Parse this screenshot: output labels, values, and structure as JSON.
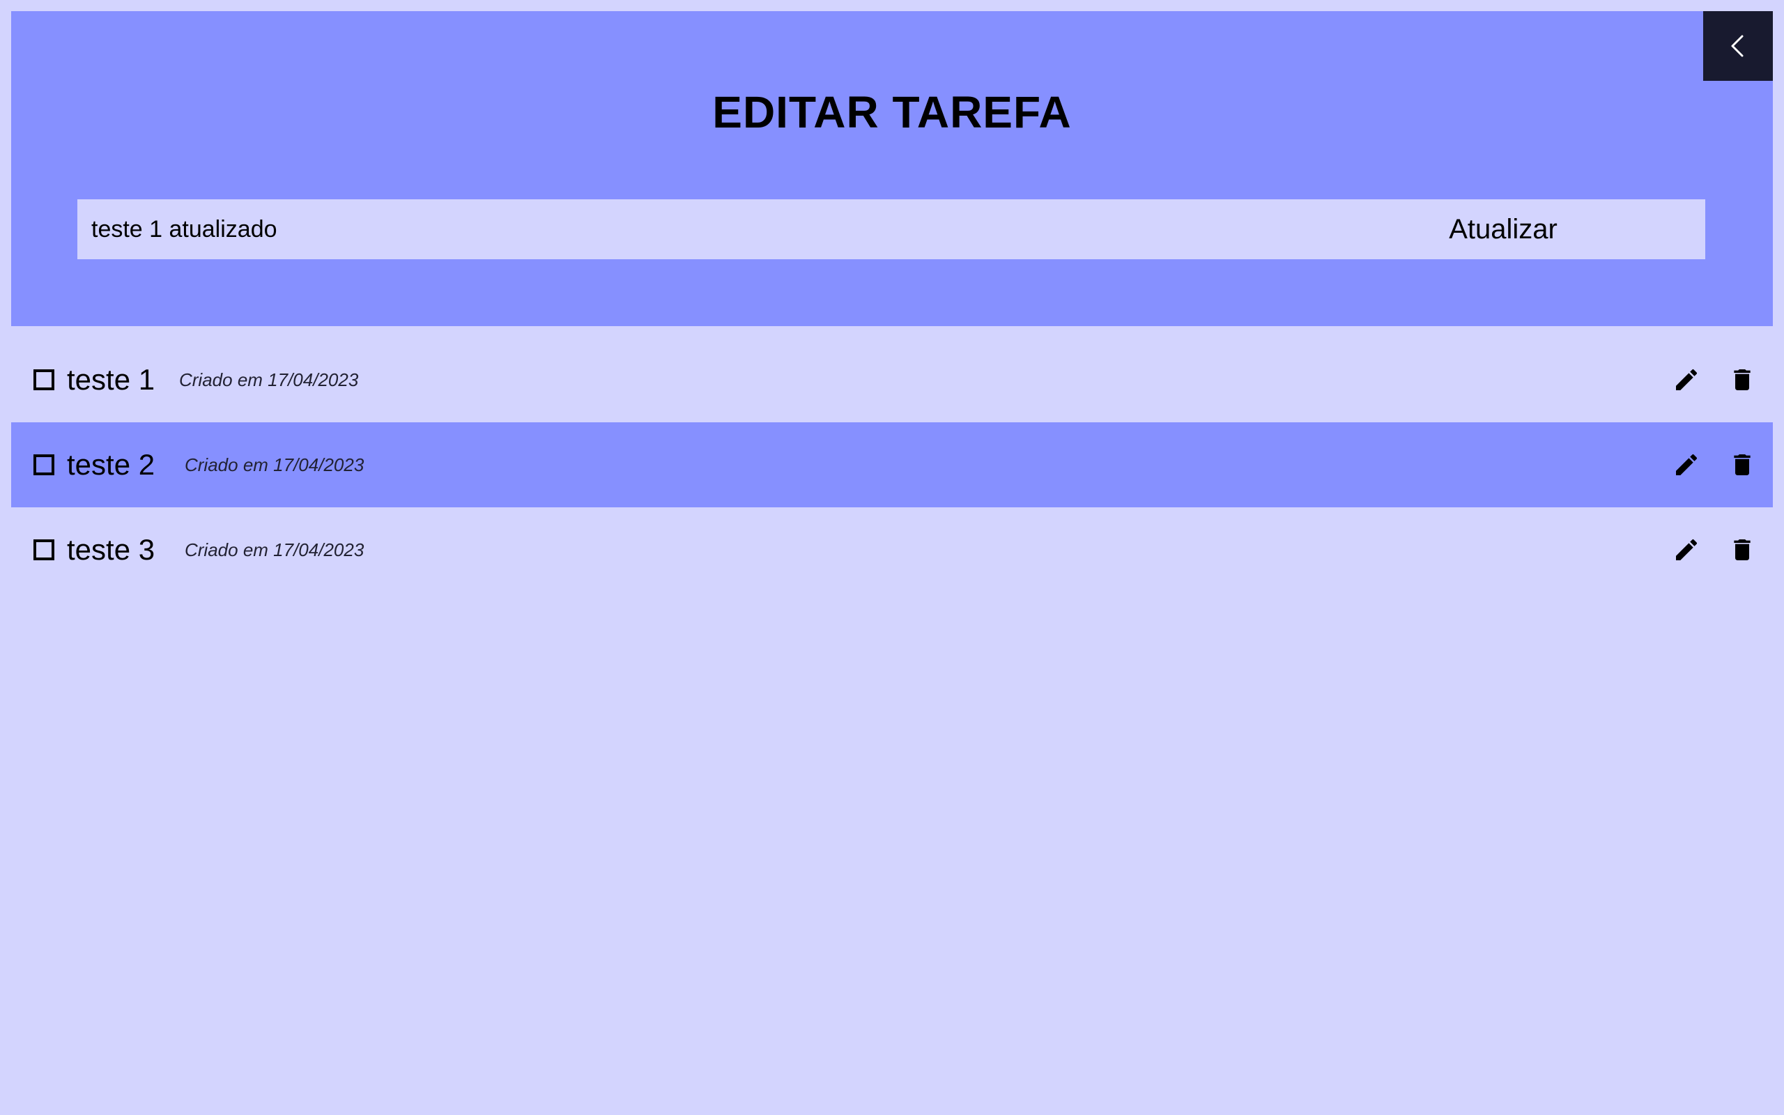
{
  "header": {
    "title": "EDITAR TAREFA",
    "back_icon": "chevron-left-icon",
    "background": "#8690ff"
  },
  "edit_form": {
    "value": "teste 1 atualizado",
    "submit_label": "Atualizar"
  },
  "tasks": [
    {
      "name": "teste 1",
      "created": "Criado em 17/04/2023",
      "checked": false,
      "edit_icon": "pencil-icon",
      "delete_icon": "trash-icon"
    },
    {
      "name": "teste 2",
      "created": "Criado em 17/04/2023",
      "checked": false,
      "edit_icon": "pencil-icon",
      "delete_icon": "trash-icon"
    },
    {
      "name": "teste 3",
      "created": "Criado em 17/04/2023",
      "checked": false,
      "edit_icon": "pencil-icon",
      "delete_icon": "trash-icon"
    }
  ],
  "colors": {
    "page_background": "#d3d4fe",
    "accent": "#8690ff",
    "back_button": "#181a2f"
  }
}
